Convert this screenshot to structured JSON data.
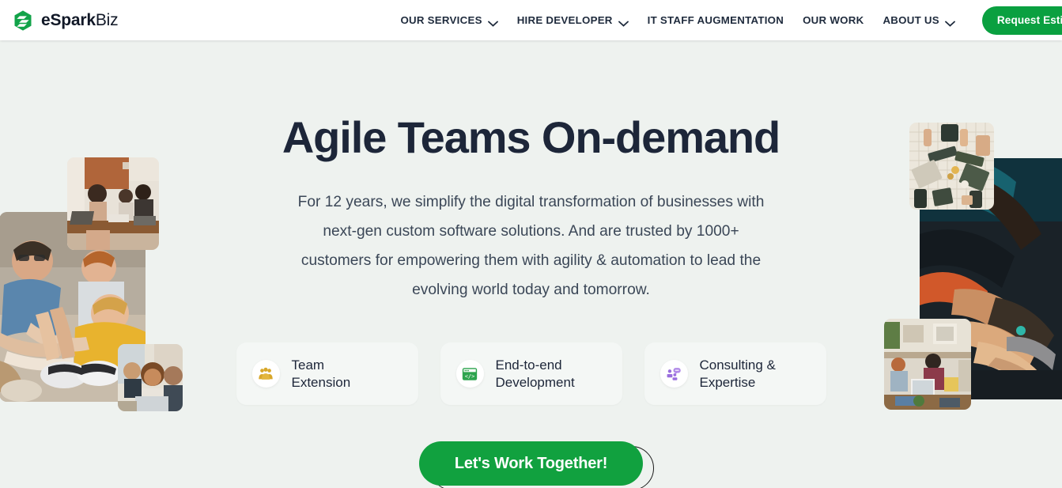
{
  "brand": {
    "name_bold": "eSpark",
    "name_light": "Biz",
    "logo_icon": "espark-hexagon-logo",
    "accent_green": "#0aa040",
    "dark_navy": "#1d2639",
    "page_background": "#eef2ef"
  },
  "nav": {
    "items": [
      {
        "label": "OUR SERVICES",
        "has_dropdown": true,
        "icon": "chevron-down-icon"
      },
      {
        "label": "HIRE DEVELOPER",
        "has_dropdown": true,
        "icon": "chevron-down-icon"
      },
      {
        "label": "IT STAFF AUGMENTATION",
        "has_dropdown": false
      },
      {
        "label": "OUR WORK",
        "has_dropdown": false
      },
      {
        "label": "ABOUT US",
        "has_dropdown": true,
        "icon": "chevron-down-icon"
      }
    ],
    "estimate_button": "Request Estimate"
  },
  "hero": {
    "title": "Agile Teams On-demand",
    "subtitle": "For 12 years, we simplify the digital transformation of businesses with next-gen custom software solutions. And are trusted by 1000+ customers for empowering them with agility & automation to lead the evolving world today and tomorrow.",
    "cta_label": "Let's Work Together!"
  },
  "cards": [
    {
      "label": "Team\nExtension",
      "icon": "team-group-icon",
      "icon_color": "#d8a72a"
    },
    {
      "label": "End-to-end\nDevelopment",
      "icon": "code-window-icon",
      "icon_color": "#2da44e"
    },
    {
      "label": "Consulting &\nExpertise",
      "icon": "consulting-people-icon",
      "icon_color": "#9a6ede"
    }
  ],
  "photos": {
    "left_top": "team-meeting-table-photo",
    "left_main": "hands-together-teamwork-photo",
    "left_small": "woman-laptop-office-photo",
    "right_top": "overhead-desk-keyboards-photo",
    "right_main": "hands-stacked-closeup-photo",
    "right_small": "office-workers-desks-photo"
  }
}
